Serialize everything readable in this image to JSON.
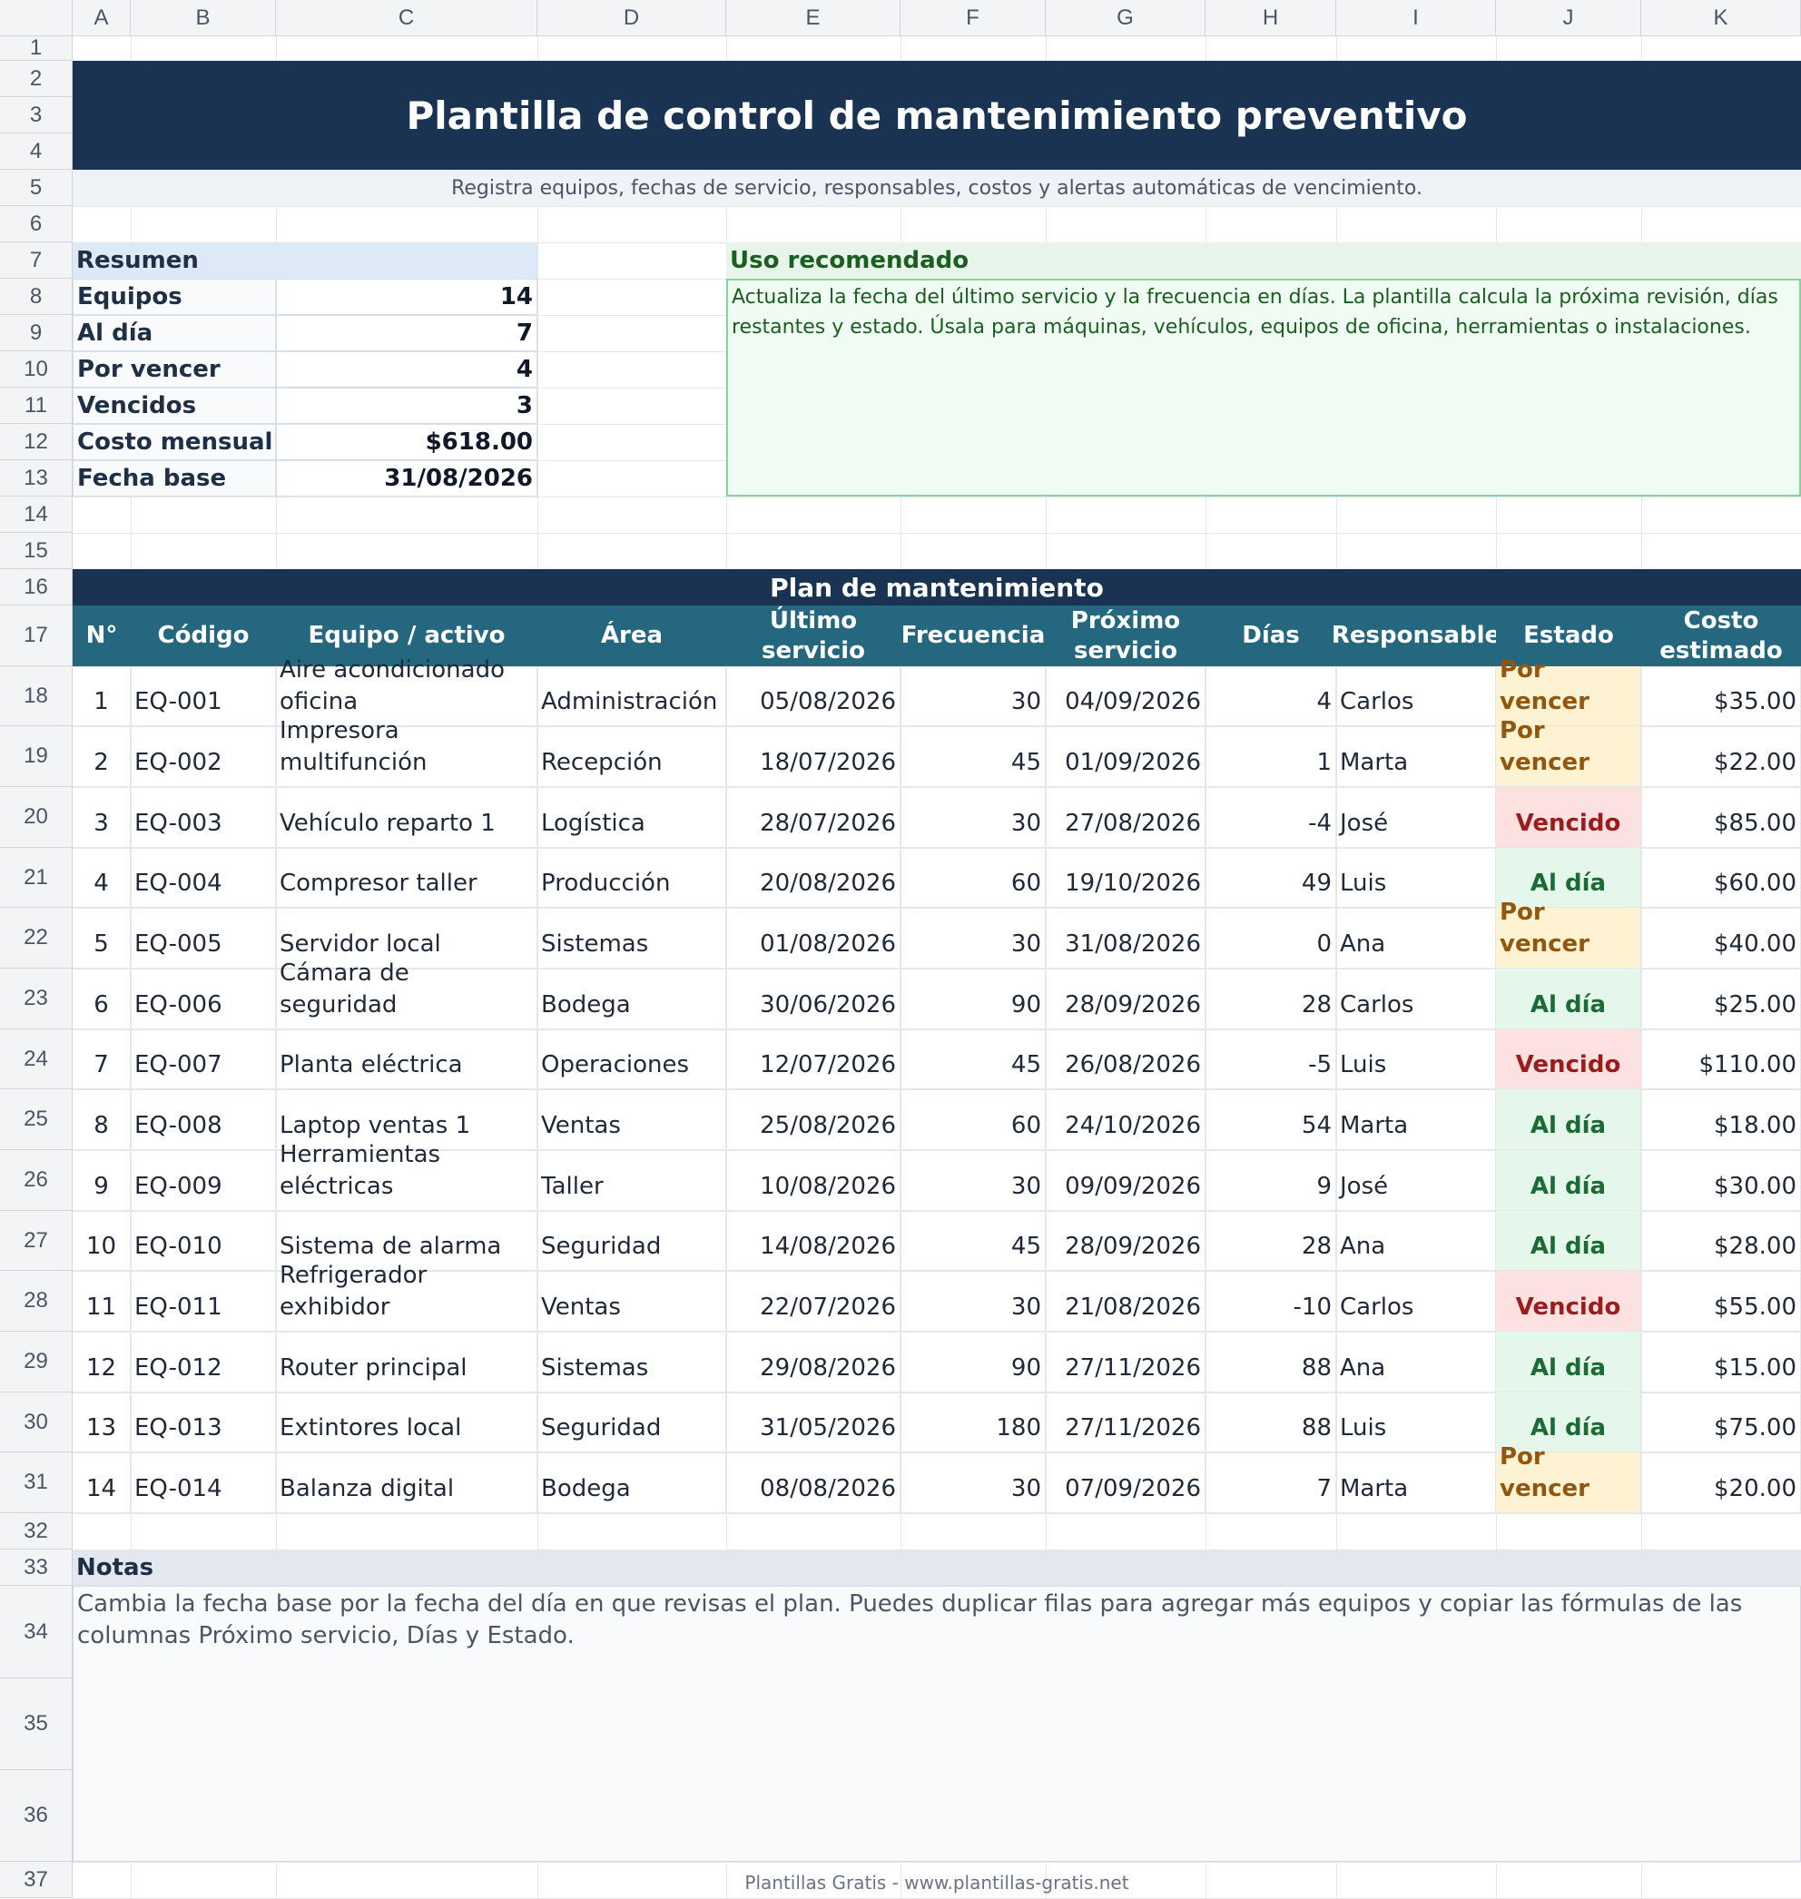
{
  "columns": [
    "A",
    "B",
    "C",
    "D",
    "E",
    "F",
    "G",
    "H",
    "I",
    "J",
    "K"
  ],
  "rows": [
    "1",
    "2",
    "3",
    "4",
    "5",
    "6",
    "7",
    "8",
    "9",
    "10",
    "11",
    "12",
    "13",
    "14",
    "15",
    "16",
    "17",
    "18",
    "19",
    "20",
    "21",
    "22",
    "23",
    "24",
    "25",
    "26",
    "27",
    "28",
    "29",
    "30",
    "31",
    "32",
    "33",
    "34",
    "35",
    "36",
    "37"
  ],
  "title": "Plantilla de control de mantenimiento preventivo",
  "subtitle": "Registra equipos, fechas de servicio, responsables, costos y alertas automáticas de vencimiento.",
  "summary": {
    "heading": "Resumen",
    "items": [
      {
        "label": "Equipos",
        "value": "14"
      },
      {
        "label": "Al día",
        "value": "7"
      },
      {
        "label": "Por vencer",
        "value": "4"
      },
      {
        "label": "Vencidos",
        "value": "3"
      },
      {
        "label": "Costo mensual",
        "value": "$618.00"
      },
      {
        "label": "Fecha base",
        "value": "31/08/2026"
      }
    ]
  },
  "usage": {
    "heading": "Uso recomendado",
    "text": "Actualiza la fecha del último servicio y la frecuencia en días. La plantilla calcula la próxima revisión, días restantes y estado. Úsala para máquinas, vehículos, equipos de oficina, herramientas o instalaciones."
  },
  "plan": {
    "heading": "Plan de mantenimiento",
    "headers": [
      "N°",
      "Código",
      "Equipo / activo",
      "Área",
      "Último servicio",
      "Frecuencia",
      "Próximo servicio",
      "Días",
      "Responsable",
      "Estado",
      "Costo estimado"
    ],
    "rows": [
      [
        "1",
        "EQ-001",
        "Aire acondicionado oficina",
        "Administración",
        "05/08/2026",
        "30",
        "04/09/2026",
        "4",
        "Carlos",
        "Por vencer",
        "$35.00"
      ],
      [
        "2",
        "EQ-002",
        "Impresora multifunción",
        "Recepción",
        "18/07/2026",
        "45",
        "01/09/2026",
        "1",
        "Marta",
        "Por vencer",
        "$22.00"
      ],
      [
        "3",
        "EQ-003",
        "Vehículo reparto 1",
        "Logística",
        "28/07/2026",
        "30",
        "27/08/2026",
        "-4",
        "José",
        "Vencido",
        "$85.00"
      ],
      [
        "4",
        "EQ-004",
        "Compresor taller",
        "Producción",
        "20/08/2026",
        "60",
        "19/10/2026",
        "49",
        "Luis",
        "Al día",
        "$60.00"
      ],
      [
        "5",
        "EQ-005",
        "Servidor local",
        "Sistemas",
        "01/08/2026",
        "30",
        "31/08/2026",
        "0",
        "Ana",
        "Por vencer",
        "$40.00"
      ],
      [
        "6",
        "EQ-006",
        "Cámara de seguridad",
        "Bodega",
        "30/06/2026",
        "90",
        "28/09/2026",
        "28",
        "Carlos",
        "Al día",
        "$25.00"
      ],
      [
        "7",
        "EQ-007",
        "Planta eléctrica",
        "Operaciones",
        "12/07/2026",
        "45",
        "26/08/2026",
        "-5",
        "Luis",
        "Vencido",
        "$110.00"
      ],
      [
        "8",
        "EQ-008",
        "Laptop ventas 1",
        "Ventas",
        "25/08/2026",
        "60",
        "24/10/2026",
        "54",
        "Marta",
        "Al día",
        "$18.00"
      ],
      [
        "9",
        "EQ-009",
        "Herramientas eléctricas",
        "Taller",
        "10/08/2026",
        "30",
        "09/09/2026",
        "9",
        "José",
        "Al día",
        "$30.00"
      ],
      [
        "10",
        "EQ-010",
        "Sistema de alarma",
        "Seguridad",
        "14/08/2026",
        "45",
        "28/09/2026",
        "28",
        "Ana",
        "Al día",
        "$28.00"
      ],
      [
        "11",
        "EQ-011",
        "Refrigerador exhibidor",
        "Ventas",
        "22/07/2026",
        "30",
        "21/08/2026",
        "-10",
        "Carlos",
        "Vencido",
        "$55.00"
      ],
      [
        "12",
        "EQ-012",
        "Router principal",
        "Sistemas",
        "29/08/2026",
        "90",
        "27/11/2026",
        "88",
        "Ana",
        "Al día",
        "$15.00"
      ],
      [
        "13",
        "EQ-013",
        "Extintores local",
        "Seguridad",
        "31/05/2026",
        "180",
        "27/11/2026",
        "88",
        "Luis",
        "Al día",
        "$75.00"
      ],
      [
        "14",
        "EQ-014",
        "Balanza digital",
        "Bodega",
        "08/08/2026",
        "30",
        "07/09/2026",
        "7",
        "Marta",
        "Por vencer",
        "$20.00"
      ]
    ]
  },
  "notes": {
    "heading": "Notas",
    "text": "Cambia la fecha base por la fecha del día en que revisas el plan. Puedes duplicar filas para agregar más equipos y copiar las fórmulas de las columnas Próximo servicio, Días y Estado."
  },
  "footer": "Plantillas Gratis - www.plantillas-gratis.net",
  "colors": {
    "banner": "#1a3352",
    "table_header": "#24677f",
    "status_ok": "#1b6b34",
    "status_warn": "#92570f",
    "status_bad": "#9b1c1c"
  }
}
